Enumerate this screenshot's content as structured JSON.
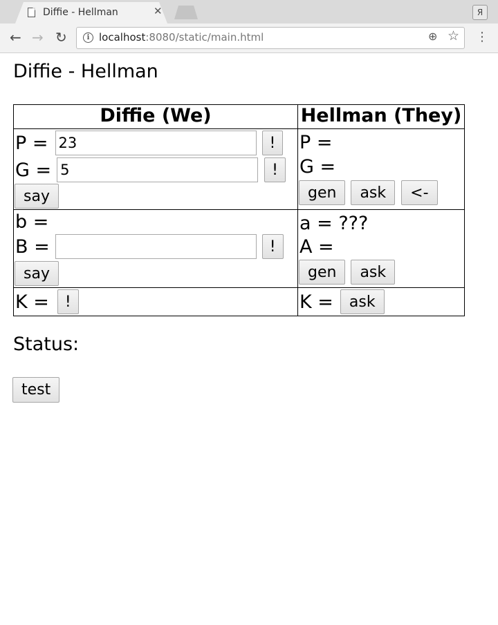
{
  "browser": {
    "tab_title": "Diffie - Hellman",
    "tab_close": "✕",
    "profile_label": "Я",
    "url_host": "localhost",
    "url_path": ":8080/static/main.html",
    "icons": [
      "doc-icon",
      "back-icon",
      "forward-icon",
      "reload-icon",
      "info-icon",
      "zoom-icon",
      "star-icon",
      "menu-icon"
    ]
  },
  "page": {
    "title": "Diffie - Hellman",
    "status_label": "Status:",
    "test_button": "test"
  },
  "table": {
    "headers": {
      "we": "Diffie (We)",
      "they": "Hellman (They)"
    },
    "we": {
      "p_label": "P =",
      "p_value": "23",
      "p_button": "!",
      "g_label": "G =",
      "g_value": "5",
      "g_button": "!",
      "say1": "say",
      "b_label": "b =",
      "B_label": "B =",
      "B_value": "",
      "B_button": "!",
      "say2": "say",
      "k_label": "K =",
      "k_button": "!"
    },
    "they": {
      "p_label": "P =",
      "g_label": "G =",
      "gen1": "gen",
      "ask1": "ask",
      "arrow": "<-",
      "a_label": "a = ???",
      "A_label": "A =",
      "gen2": "gen",
      "ask2": "ask",
      "k_label": "K =",
      "k_ask": "ask"
    }
  }
}
